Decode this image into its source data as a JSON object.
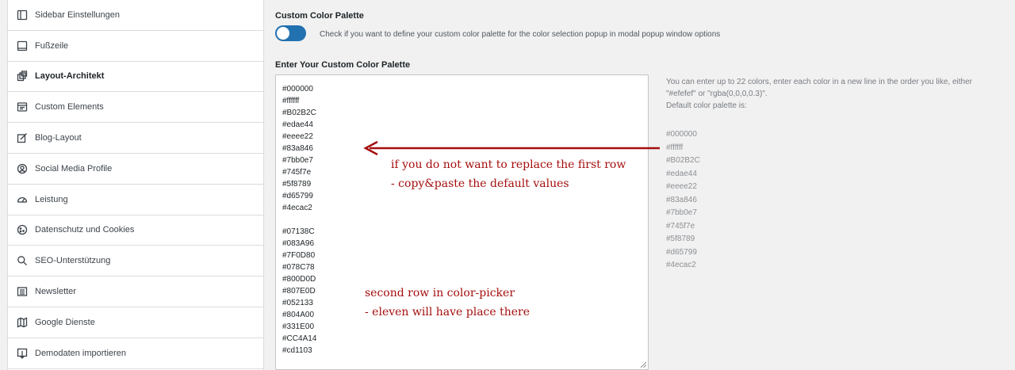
{
  "sidebar": {
    "items": [
      {
        "label": "Sidebar Einstellungen",
        "icon": "sidebar-icon"
      },
      {
        "label": "Fußzeile",
        "icon": "footer-icon"
      },
      {
        "label": "Layout-Architekt",
        "icon": "layout-icon",
        "active": true
      },
      {
        "label": "Custom Elements",
        "icon": "elements-icon"
      },
      {
        "label": "Blog-Layout",
        "icon": "edit-icon"
      },
      {
        "label": "Social Media Profile",
        "icon": "profile-icon"
      },
      {
        "label": "Leistung",
        "icon": "gauge-icon"
      },
      {
        "label": "Datenschutz und Cookies",
        "icon": "cookie-icon"
      },
      {
        "label": "SEO-Unterstützung",
        "icon": "search-icon"
      },
      {
        "label": "Newsletter",
        "icon": "newsletter-icon"
      },
      {
        "label": "Google Dienste",
        "icon": "map-icon"
      },
      {
        "label": "Demodaten importieren",
        "icon": "import-icon"
      }
    ]
  },
  "main": {
    "palette_title": "Custom Color Palette",
    "toggle_desc": "Check if you want to define your custom color palette for the color selection popup in modal popup window options",
    "toggle_color": "#2271b1",
    "field_title": "Enter Your Custom Color Palette",
    "textarea_row1": [
      "#000000",
      "#ffffff",
      "#B02B2C",
      "#edae44",
      "#eeee22",
      "#83a846",
      "#7bb0e7",
      "#745f7e",
      "#5f8789",
      "#d65799",
      "#4ecac2"
    ],
    "textarea_row2": [
      "#07138C",
      "#083A96",
      "#7F0D80",
      "#078C78",
      "#800D0D",
      "#807E0D",
      "#052133",
      "#804A00",
      "#331E00",
      "#CC4A14",
      "#cd1103"
    ],
    "help_line1": "You can enter up to 22 colors, enter each color in a new line in the order you like, either",
    "help_line2": "\"#efefef\" or \"rgba(0,0,0,0.3)\".",
    "help_line3": "Default color palette is:",
    "default_colors": [
      "#000000",
      "#ffffff",
      "#B02B2C",
      "#edae44",
      "#eeee22",
      "#83a846",
      "#7bb0e7",
      "#745f7e",
      "#5f8789",
      "#d65799",
      "#4ecac2"
    ]
  },
  "annotations": {
    "color": "#a50e0e",
    "note1_line1": "if you do not want to replace the first row",
    "note1_line2": "- copy&paste the default values",
    "note2_line1": "second row in color-picker",
    "note2_line2": "- eleven will have place there"
  }
}
